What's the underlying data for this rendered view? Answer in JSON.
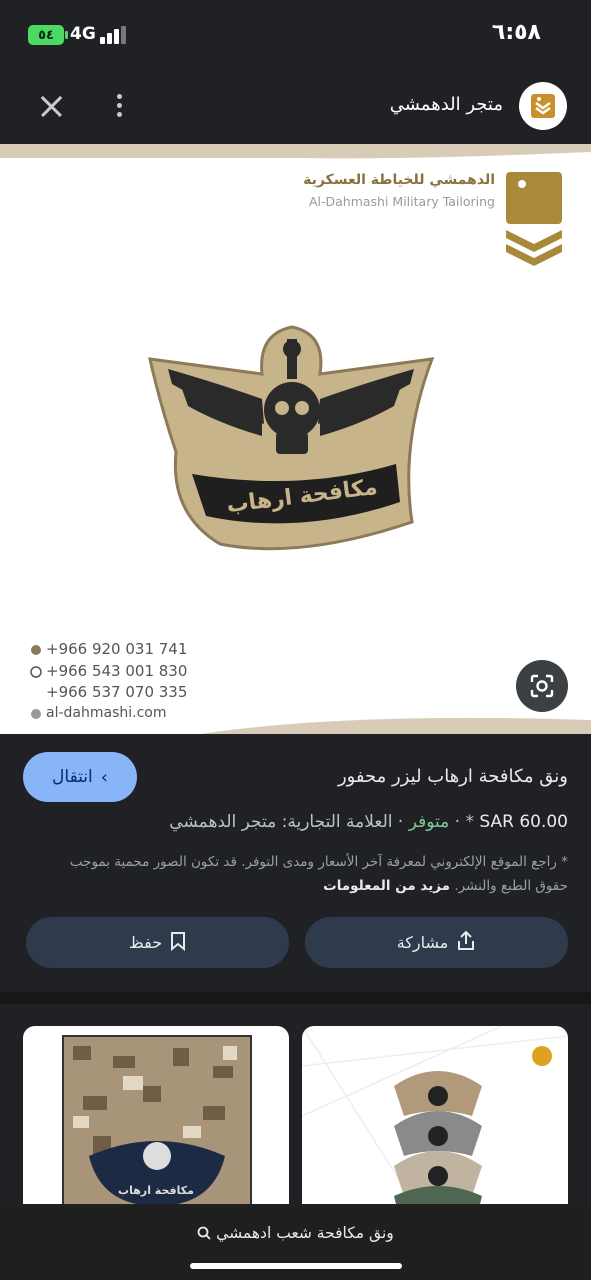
{
  "status_bar": {
    "time": "٦:٥٨",
    "battery": "٥٤",
    "network": "4G"
  },
  "header": {
    "site_title": "متجر الدهمشي",
    "icons": [
      "close-icon",
      "more-vert-icon",
      "site-logo"
    ]
  },
  "main_image": {
    "brand_name_ar": "الدهمشي للخياطة العسكرية",
    "brand_name_en": "Al-Dahmashi Military Tailoring",
    "patch_text": "مكافحة ارهاب",
    "phones": [
      "+966 920 031 741",
      "+966 543 001 830",
      "+966 537 070 335"
    ],
    "website": "al-dahmashi.com"
  },
  "product": {
    "visit_label": "انتقال",
    "title": "ونق مكافحة ارهاب ليزر محفور",
    "price": "SAR 60.00",
    "stock": "متوفر",
    "brand_label": "العلامة التجارية: متجر الدهمشي",
    "disclaimer": "* راجع الموقع الإلكتروني لمعرفة آخر الأسعار ومدى التوفر. قد تكون الصور محمية بموجب حقوق الطبع والنشر.",
    "more_info": "مزيد من المعلومات",
    "save_label": "حفظ",
    "share_label": "مشاركة"
  },
  "related": {
    "left_patch_text": "مكافحة ارهاب"
  },
  "bottom_bar": {
    "search_query": "ونق مكافحة شعب ادهمشي"
  },
  "colors": {
    "background": "#202124",
    "accent_button": "#8ab4f8",
    "in_stock": "#81c995",
    "patch_tan": "#c8b48a"
  }
}
